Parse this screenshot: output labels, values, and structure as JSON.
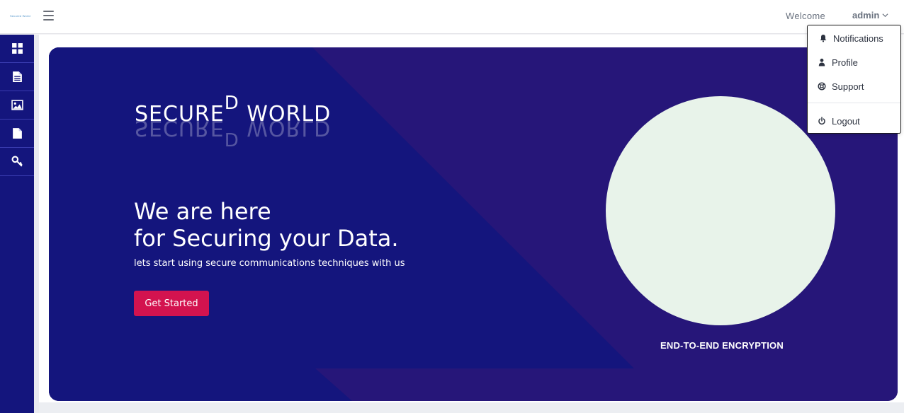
{
  "header": {
    "logo_text": "Secured World",
    "welcome": "Welcome",
    "username": "admin"
  },
  "sidebar": {
    "items": [
      {
        "icon": "dashboard-icon"
      },
      {
        "icon": "document-text-icon"
      },
      {
        "icon": "image-icon"
      },
      {
        "icon": "file-icon"
      },
      {
        "icon": "key-icon"
      }
    ]
  },
  "dropdown": {
    "items": [
      {
        "label": "Notifications",
        "icon": "bell-icon"
      },
      {
        "label": "Profile",
        "icon": "user-icon"
      },
      {
        "label": "Support",
        "icon": "lifebuoy-icon"
      },
      {
        "label": "Logout",
        "icon": "power-icon"
      }
    ]
  },
  "hero": {
    "brand_left": "SECURE",
    "brand_sup": "D",
    "brand_right": " WORLD",
    "headline_1": "We are here",
    "headline_2": "for Securing your Data.",
    "subline": "lets start using secure communications techniques with us",
    "cta_label": "Get Started",
    "caption": "END-TO-END ENCRYPTION"
  },
  "colors": {
    "sidebar": "#14157d",
    "hero_dark": "#14157d",
    "hero_purple": "#261679",
    "accent": "#d3134f",
    "circle": "#e8f3ea"
  }
}
